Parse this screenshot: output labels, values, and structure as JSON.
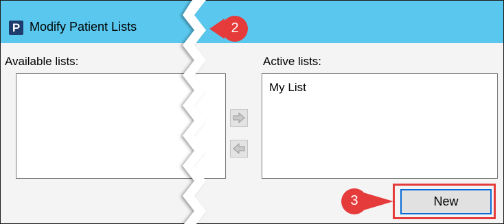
{
  "window": {
    "app_icon_letter": "P",
    "title": "Modify Patient Lists"
  },
  "available": {
    "label": "Available lists:",
    "items": []
  },
  "active": {
    "label": "Active lists:",
    "items": [
      "My List"
    ]
  },
  "buttons": {
    "new_label": "New"
  },
  "callouts": {
    "step2": "2",
    "step3": "3"
  },
  "colors": {
    "titlebar": "#5ac8ee",
    "callout": "#e53b3b",
    "focus_border": "#0a6cd6"
  },
  "icons": {
    "move_right": "arrow-right-icon",
    "move_left": "arrow-left-icon"
  }
}
